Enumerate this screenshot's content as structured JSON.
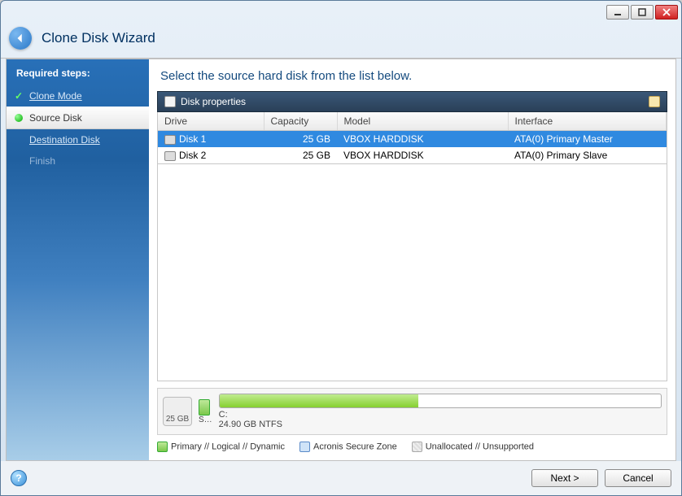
{
  "window": {
    "title": "Clone Disk Wizard"
  },
  "sidebar": {
    "heading": "Required steps:",
    "steps": [
      {
        "label": "Clone Mode",
        "state": "done"
      },
      {
        "label": "Source Disk",
        "state": "current"
      },
      {
        "label": "Destination Disk",
        "state": "pending"
      },
      {
        "label": "Finish",
        "state": "disabled"
      }
    ]
  },
  "main": {
    "instruction": "Select the source hard disk from the list below.",
    "panel_label": "Disk properties",
    "columns": {
      "drive": "Drive",
      "capacity": "Capacity",
      "model": "Model",
      "interface": "Interface"
    },
    "rows": [
      {
        "drive": "Disk 1",
        "capacity": "25 GB",
        "model": "VBOX HARDDISK",
        "interface": "ATA(0) Primary Master",
        "selected": true
      },
      {
        "drive": "Disk 2",
        "capacity": "25 GB",
        "model": "VBOX HARDDISK",
        "interface": "ATA(0) Primary Slave",
        "selected": false
      }
    ]
  },
  "bar": {
    "disk_total": "25 GB",
    "sys_label": "S…",
    "vol_letter": "C:",
    "vol_detail": "24.90 GB  NTFS",
    "fill_pct": 45
  },
  "legend": {
    "primary": "Primary // Logical // Dynamic",
    "secure": "Acronis Secure Zone",
    "unalloc": "Unallocated // Unsupported"
  },
  "footer": {
    "next": "Next >",
    "cancel": "Cancel"
  }
}
